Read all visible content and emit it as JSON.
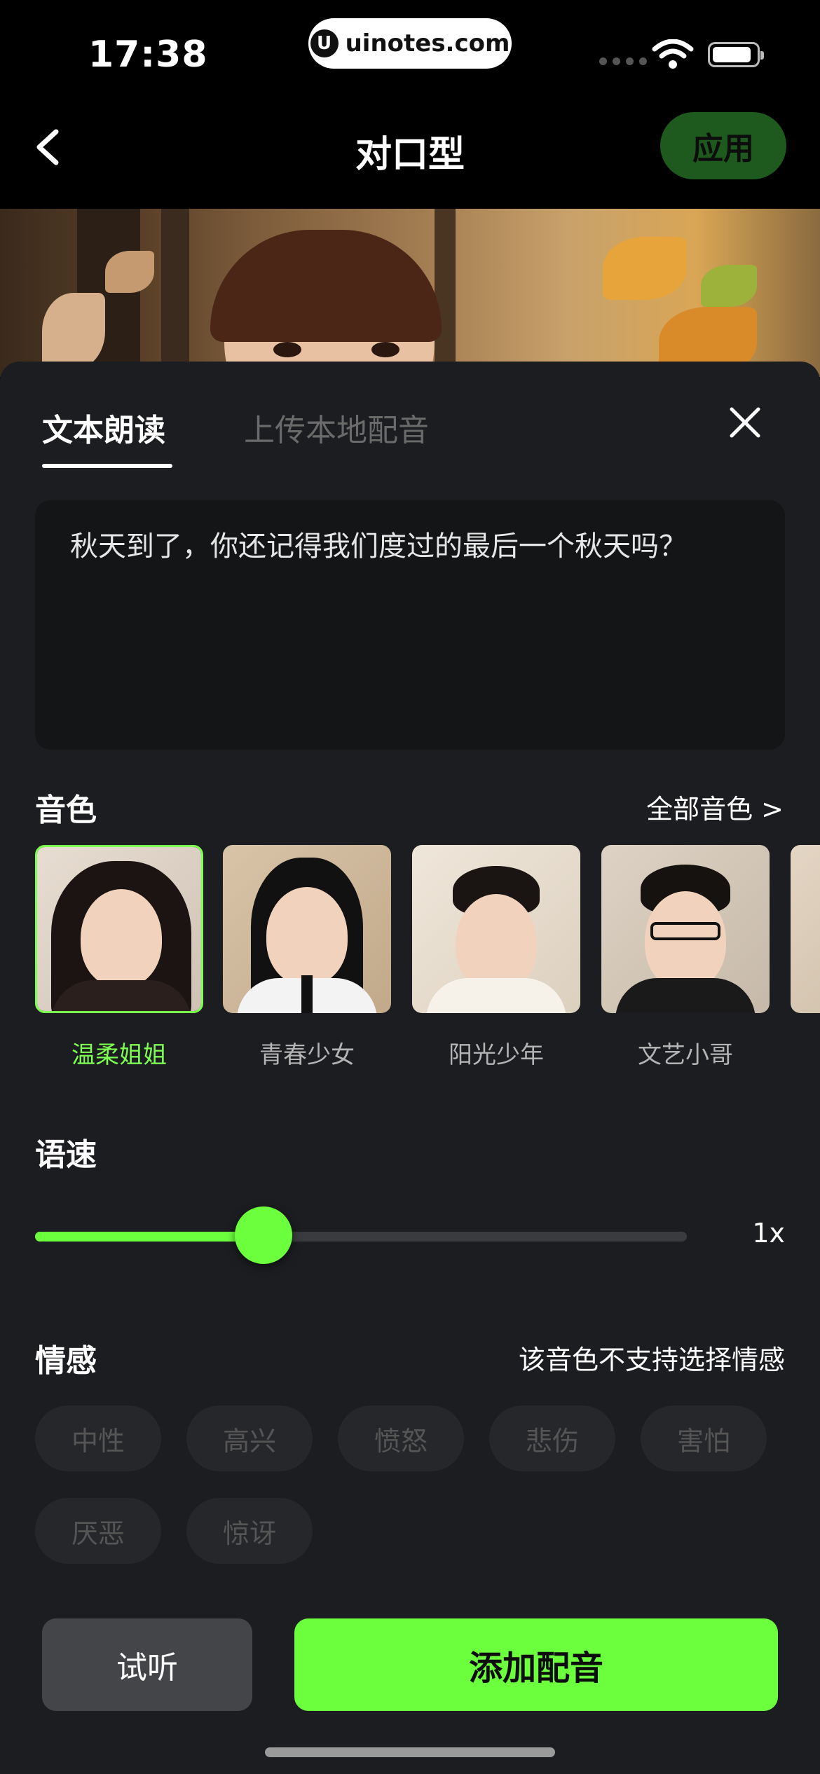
{
  "status": {
    "time": "17:38",
    "url": "uinotes.com"
  },
  "nav": {
    "title": "对口型",
    "apply_label": "应用"
  },
  "tabs": [
    {
      "label": "文本朗读",
      "active": true
    },
    {
      "label": "上传本地配音",
      "active": false
    }
  ],
  "text_input": {
    "value": "秋天到了，你还记得我们度过的最后一个秋天吗？"
  },
  "voice_section": {
    "title": "音色",
    "all_voices_label": "全部音色 >",
    "voices": [
      {
        "name": "温柔姐姐",
        "selected": true
      },
      {
        "name": "青春少女",
        "selected": false
      },
      {
        "name": "阳光少年",
        "selected": false
      },
      {
        "name": "文艺小哥",
        "selected": false
      }
    ]
  },
  "speed_section": {
    "title": "语速",
    "value_label": "1x",
    "slider_fraction": 0.35
  },
  "emotion_section": {
    "title": "情感",
    "note": "该音色不支持选择情感",
    "chips": [
      "中性",
      "高兴",
      "愤怒",
      "悲伤",
      "害怕",
      "厌恶",
      "惊讶"
    ]
  },
  "actions": {
    "preview_label": "试听",
    "add_label": "添加配音"
  },
  "colors": {
    "accent": "#6cff3e",
    "sheet_bg": "#1c1d20",
    "apply_bg": "#1e5a1e"
  }
}
